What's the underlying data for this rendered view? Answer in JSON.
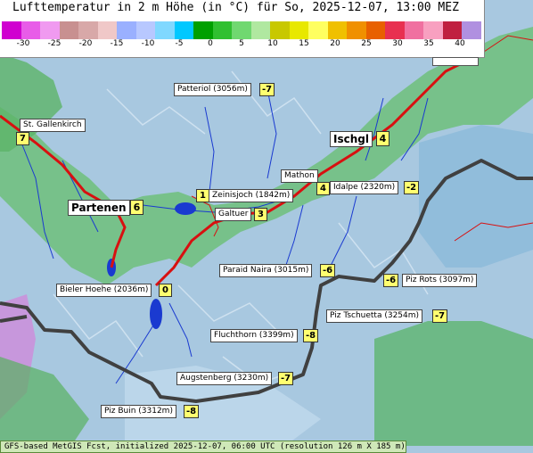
{
  "title": "Lufttemperatur in 2 m Höhe (in °C) für So, 2025-12-07, 13:00 MEZ",
  "legend": {
    "colors": [
      "#d000d0",
      "#e85ce8",
      "#f09af0",
      "#c89090",
      "#d8a8a8",
      "#f0c8c8",
      "#9ab0ff",
      "#b8c8ff",
      "#80d8ff",
      "#00c8ff",
      "#00a000",
      "#30c030",
      "#70d870",
      "#b0e8a0",
      "#c8c800",
      "#e8e800",
      "#ffff60",
      "#f0c000",
      "#f09000",
      "#e86000",
      "#e83050",
      "#f070a0",
      "#f8a0c0",
      "#c02040",
      "#b090e0"
    ],
    "ticks": [
      "-30",
      "-25",
      "-20",
      "-15",
      "-10",
      "-5",
      "0",
      "5",
      "10",
      "15",
      "20",
      "25",
      "30",
      "35",
      "40"
    ]
  },
  "places": [
    {
      "name": "Patteriol (3056m)",
      "value": "-7"
    },
    {
      "name": "St. Gallenkirch",
      "value": "7"
    },
    {
      "name": "Ischgl",
      "value": "4"
    },
    {
      "name": "Mathon",
      "value": "4"
    },
    {
      "name": "Idalpe (2320m)",
      "value": "-2"
    },
    {
      "name": "Zeinisjoch (1842m)",
      "value": "1"
    },
    {
      "name": "Partenen",
      "value": "6"
    },
    {
      "name": "Galtuer",
      "value": "3"
    },
    {
      "name": "Paraid Naira (3015m)",
      "value": "-6"
    },
    {
      "name": "Piz Rots (3097m)",
      "value": "-6"
    },
    {
      "name": "Bieler Hoehe (2036m)",
      "value": "0"
    },
    {
      "name": "Piz Tschuetta (3254m)",
      "value": "-7"
    },
    {
      "name": "Fluchthorn (3399m)",
      "value": "-8"
    },
    {
      "name": "Augstenberg (3230m)",
      "value": "-7"
    },
    {
      "name": "Piz Buin (3312m)",
      "value": "-8"
    }
  ],
  "footer": "GFS-based MetGIS Fcst, initialized 2025-12-07, 06:00 UTC  (resolution 126 m X 185 m)"
}
